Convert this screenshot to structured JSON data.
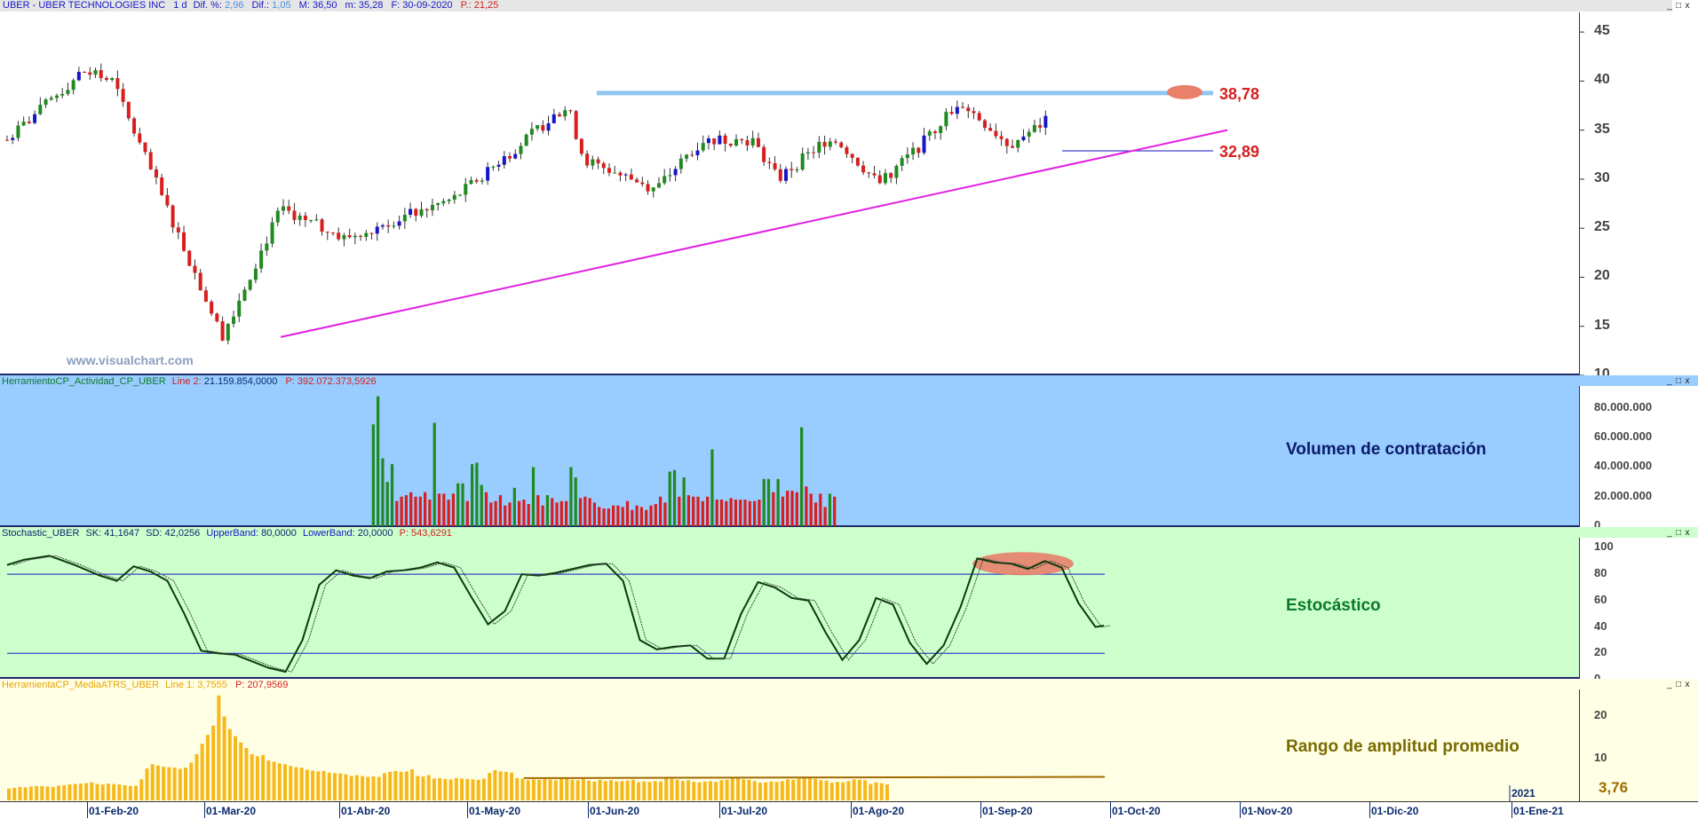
{
  "price_header": {
    "symbol": "UBER - UBER TECHNOLOGIES INC",
    "interval": "1 d",
    "dif_pct_label": "Dif. %:",
    "dif_pct": "2,96",
    "dif_label": "Dif.:",
    "dif": "1,05",
    "max_label": "M:",
    "max": "36,50",
    "min_label": "m:",
    "min": "35,28",
    "date_label": "F:",
    "date": "30-09-2020",
    "p_label": "P.:",
    "p": "21,25"
  },
  "volume_header": {
    "name": "HerramientoCP_Actividad_CP_UBER",
    "line_label": "Line 2:",
    "line": "21.159.854,0000",
    "p_label": "P:",
    "p": "392.072.373,5926"
  },
  "stoch_header": {
    "name": "Stochastic_UBER",
    "sk_label": "SK:",
    "sk": "41,1647",
    "sd_label": "SD:",
    "sd": "42,0256",
    "ub_label": "UpperBand:",
    "ub": "80,0000",
    "lb_label": "LowerBand:",
    "lb": "20,0000",
    "p_label": "P:",
    "p": "543,6291"
  },
  "atr_header": {
    "name": "HerramientaCP_MediaATRS_UBER",
    "line_label": "Line 1:",
    "line": "3,7555",
    "p_label": "P:",
    "p": "207,9569"
  },
  "watermark": "www.visualchart.com",
  "window_controls": [
    "_",
    "□",
    "x"
  ],
  "colors": {
    "up": "#1f8a1f",
    "down": "#d81e1e",
    "inside": "#1616c8",
    "resistance": "#8ec6ef",
    "trend": "#e020e0",
    "vol_bg": "#99ccff",
    "stoch_bg": "#ccffcc",
    "atr_bg": "#ffffe6",
    "atr_bar": "#f7b81c"
  },
  "chart_data": [
    {
      "type": "candlestick",
      "title": "UBER - UBER TECHNOLOGIES INC",
      "ylim": [
        10,
        47
      ],
      "yticks": [
        "45",
        "40",
        "35",
        "30",
        "25",
        "20",
        "15",
        "10"
      ],
      "levels": [
        {
          "label": "38,78",
          "value": 38.78
        },
        {
          "label": "32,89",
          "value": 32.89
        }
      ],
      "key_closes": [
        {
          "date": "2020-01-27",
          "close": 34
        },
        {
          "date": "2020-02-14",
          "close": 41
        },
        {
          "date": "2020-02-21",
          "close": 40
        },
        {
          "date": "2020-03-18",
          "close": 14
        },
        {
          "date": "2020-04-01",
          "close": 27
        },
        {
          "date": "2020-04-16",
          "close": 24
        },
        {
          "date": "2020-05-12",
          "close": 28
        },
        {
          "date": "2020-06-08",
          "close": 37.5
        },
        {
          "date": "2020-06-12",
          "close": 32
        },
        {
          "date": "2020-06-29",
          "close": 29
        },
        {
          "date": "2020-07-10",
          "close": 34
        },
        {
          "date": "2020-07-22",
          "close": 34
        },
        {
          "date": "2020-07-28",
          "close": 30
        },
        {
          "date": "2020-08-10",
          "close": 34.5
        },
        {
          "date": "2020-08-21",
          "close": 29.5
        },
        {
          "date": "2020-08-31",
          "close": 33.5
        },
        {
          "date": "2020-09-09",
          "close": 38
        },
        {
          "date": "2020-09-21",
          "close": 33.5
        },
        {
          "date": "2020-09-30",
          "close": 36
        }
      ]
    },
    {
      "type": "bar",
      "title": "Volumen de contratación",
      "yticks": [
        "80.000.000",
        "60.000.000",
        "40.000.000",
        "20.000.000",
        "0"
      ],
      "ylim": [
        0,
        95000000
      ],
      "values": [
        69,
        88,
        46,
        30,
        42,
        17,
        20,
        21,
        23,
        20,
        20,
        23,
        18,
        70,
        22,
        22,
        18,
        22,
        29,
        29,
        17,
        42,
        43,
        28,
        23,
        16,
        17,
        21,
        14,
        16,
        26,
        17,
        18,
        15,
        40,
        21,
        14,
        21,
        19,
        16,
        17,
        17,
        40,
        33,
        19,
        20,
        19,
        16,
        13,
        12,
        12,
        14,
        14,
        13,
        17,
        11,
        14,
        13,
        11,
        14,
        15,
        20,
        16,
        37,
        38,
        20,
        33,
        21,
        20,
        20,
        17,
        20,
        52,
        18,
        18,
        17,
        19,
        18,
        18,
        18,
        17,
        17,
        18,
        32,
        32,
        23,
        32,
        20,
        24,
        24,
        23,
        67,
        27,
        22,
        16,
        22,
        13,
        22,
        20
      ],
      "first_index": 66
    },
    {
      "type": "line",
      "title": "Estocástico",
      "ylim": [
        0,
        105
      ],
      "yticks": [
        "100",
        "80",
        "60",
        "40",
        "20",
        "0"
      ],
      "bands": [
        80,
        20
      ],
      "series": [
        {
          "name": "SK",
          "points": [
            [
              0,
              87
            ],
            [
              2,
              91
            ],
            [
              5,
              94
            ],
            [
              8,
              87
            ],
            [
              11,
              79
            ],
            [
              13,
              75
            ],
            [
              15,
              86
            ],
            [
              17,
              82
            ],
            [
              19,
              75
            ],
            [
              21,
              50
            ],
            [
              23,
              22
            ],
            [
              25,
              20
            ],
            [
              27,
              19
            ],
            [
              29,
              14
            ],
            [
              31,
              9
            ],
            [
              33,
              6
            ],
            [
              35,
              30
            ],
            [
              37,
              72
            ],
            [
              39,
              83
            ],
            [
              41,
              79
            ],
            [
              43,
              77
            ],
            [
              45,
              82
            ],
            [
              47,
              83
            ],
            [
              49,
              85
            ],
            [
              51,
              89
            ],
            [
              53,
              85
            ],
            [
              55,
              63
            ],
            [
              57,
              42
            ],
            [
              59,
              52
            ],
            [
              61,
              80
            ],
            [
              63,
              79
            ],
            [
              65,
              81
            ],
            [
              67,
              84
            ],
            [
              69,
              87
            ],
            [
              71,
              88
            ],
            [
              73,
              75
            ],
            [
              75,
              30
            ],
            [
              77,
              23
            ],
            [
              79,
              25
            ],
            [
              81,
              26
            ],
            [
              83,
              16
            ],
            [
              85,
              16
            ],
            [
              87,
              50
            ],
            [
              89,
              74
            ],
            [
              91,
              70
            ],
            [
              93,
              62
            ],
            [
              95,
              60
            ],
            [
              97,
              36
            ],
            [
              99,
              15
            ],
            [
              101,
              30
            ],
            [
              103,
              62
            ],
            [
              105,
              57
            ],
            [
              107,
              28
            ],
            [
              109,
              12
            ],
            [
              111,
              26
            ],
            [
              113,
              55
            ],
            [
              115,
              92
            ],
            [
              117,
              89
            ],
            [
              119,
              88
            ],
            [
              121,
              84
            ],
            [
              123,
              90
            ],
            [
              125,
              85
            ],
            [
              127,
              58
            ],
            [
              129,
              40
            ],
            [
              130,
              41
            ]
          ]
        }
      ]
    },
    {
      "type": "bar",
      "title": "Rango de amplitud promedio",
      "ylim": [
        0,
        26
      ],
      "yticks": [
        "20",
        "10"
      ],
      "last_label": "3,76",
      "year_label": "2021",
      "values": [
        2.8,
        3,
        3.2,
        3.1,
        3.3,
        3.4,
        3.4,
        3.3,
        3.2,
        3.5,
        3.6,
        3.8,
        3.9,
        4,
        4.1,
        4.3,
        3.9,
        3.8,
        4,
        3.9,
        3.8,
        3.6,
        3.4,
        3.5,
        5,
        7.6,
        8.6,
        8.3,
        8,
        7.9,
        7.8,
        7.5,
        7.8,
        9,
        11,
        13.5,
        15.6,
        17.8,
        25,
        20,
        17,
        15.3,
        13.8,
        12.5,
        11,
        10.5,
        10.8,
        9.5,
        9.2,
        8.8,
        8.6,
        8.2,
        7.9,
        7.8,
        7.3,
        7.1,
        6.9,
        7,
        6.6,
        6.5,
        6.4,
        6.2,
        5.8,
        6,
        5.8,
        5.6,
        5.7,
        5.6,
        6.5,
        6.8,
        7,
        6.8,
        6.9,
        7.4,
        5.8,
        5.7,
        6,
        5.2,
        5.3,
        5.1,
        5,
        5.3,
        5.2,
        5.1,
        5,
        4.9,
        5.2,
        6.5,
        7.2,
        6.9,
        6.8,
        6.6,
        5.3,
        5.2,
        4.8,
        5,
        4.9,
        5.1,
        5,
        4.8,
        5.4,
        5.2,
        4.9,
        4.8,
        5.1,
        4.7,
        4.5,
        4.9,
        4.6,
        4.8,
        4.5,
        4.6,
        4.7,
        4.9,
        4.3,
        4.5,
        4.4,
        4.6,
        4.5,
        5.2,
        5.1,
        4.9,
        4.6,
        4.8,
        4.4,
        4.3,
        4.5,
        4.6,
        4.4,
        4.8,
        4.9,
        5.2,
        5.3,
        5.0,
        4.9,
        4.6,
        4.2,
        4.3,
        4.5,
        4.4,
        4.6,
        5.0,
        4.9,
        5.2,
        5.4,
        5.3,
        5.1,
        4.8,
        4.7,
        4.2,
        4.4,
        4.3,
        4.6,
        5.0,
        4.9,
        4.8,
        3.9,
        4.3,
        4.1,
        3.8
      ],
      "avg_line": [
        5.3,
        5.6
      ]
    },
    {
      "type": "axis",
      "x_ticks": [
        "01-Feb-20",
        "01-Mar-20",
        "01-Abr-20",
        "01-May-20",
        "01-Jun-20",
        "01-Jul-20",
        "01-Ago-20",
        "01-Sep-20",
        "01-Oct-20",
        "01-Nov-20",
        "01-Dic-20",
        "01-Ene-21"
      ]
    }
  ]
}
